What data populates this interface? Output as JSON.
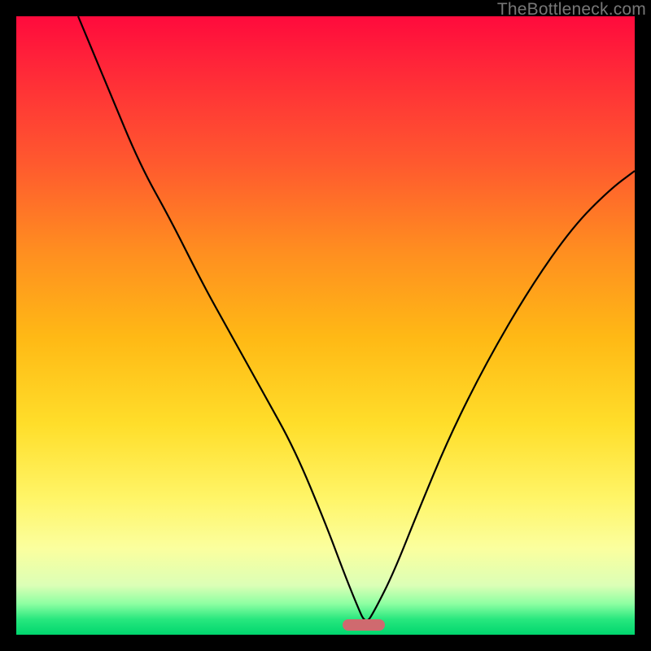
{
  "watermark": "TheBottleneck.com",
  "colors": {
    "marker": "#cf6a6f",
    "curve": "#000000",
    "frame": "#000000"
  },
  "marker": {
    "x_pct": 56.2,
    "y_pct": 98.4
  },
  "chart_data": {
    "type": "line",
    "title": "",
    "xlabel": "",
    "ylabel": "",
    "xlim": [
      0,
      100
    ],
    "ylim": [
      0,
      100
    ],
    "grid": false,
    "series": [
      {
        "name": "bottleneck-curve",
        "x": [
          10,
          15,
          20,
          25,
          30,
          35,
          40,
          45,
          50,
          53,
          55,
          56.5,
          58,
          61,
          65,
          70,
          76,
          83,
          90,
          96,
          100
        ],
        "y": [
          100,
          88,
          76,
          67,
          57,
          48,
          39,
          30,
          18,
          10,
          5,
          1.6,
          4,
          10,
          20,
          32,
          44,
          56,
          66,
          72,
          75
        ]
      }
    ],
    "annotations": [
      {
        "type": "marker",
        "shape": "pill",
        "x": 56.2,
        "y": 1.6,
        "color": "#cf6a6f"
      }
    ],
    "background_gradient": {
      "direction": "vertical",
      "stops": [
        {
          "pct": 0,
          "color": "#ff0a3c"
        },
        {
          "pct": 24,
          "color": "#ff5a2e"
        },
        {
          "pct": 52,
          "color": "#ffb915"
        },
        {
          "pct": 78,
          "color": "#fff568"
        },
        {
          "pct": 92,
          "color": "#dcffb6"
        },
        {
          "pct": 100,
          "color": "#00d66e"
        }
      ]
    }
  }
}
